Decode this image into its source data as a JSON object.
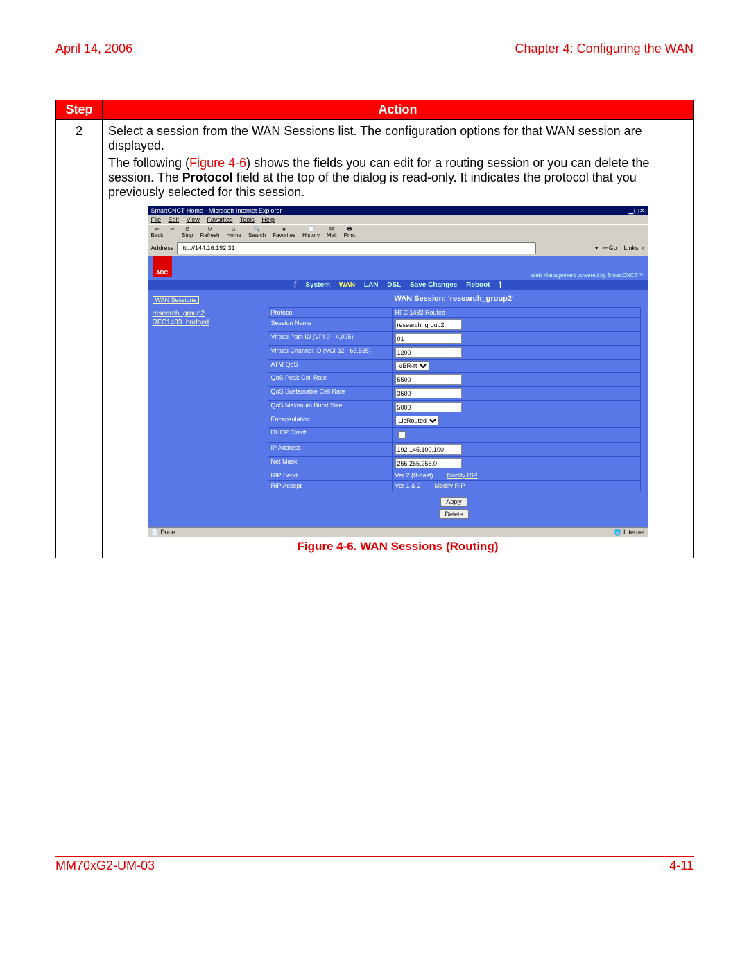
{
  "hdr": {
    "date": "April 14, 2006",
    "chap": "Chapter 4: Configuring the WAN"
  },
  "tbl": {
    "h1": "Step",
    "h2": "Action",
    "step": "2",
    "p1": "Select a session from the WAN Sessions list. The configuration options for that WAN session are displayed.",
    "p2a": "The following (",
    "figref": "Figure 4-6",
    "p2b": ") shows the fields you can edit for a routing session or you can delete the session. The ",
    "bold": "Protocol",
    "p2c": " field at the top of the dialog is read-only. It indicates the protocol that you previously selected for this session."
  },
  "figcap": "Figure 4-6. WAN Sessions (Routing)",
  "ie": {
    "title": "SmartCNCT Home - Microsoft Internet Explorer",
    "menu": [
      "File",
      "Edit",
      "View",
      "Favorites",
      "Tools",
      "Help"
    ],
    "tb": [
      "Back",
      "",
      "Stop",
      "Refresh",
      "Home",
      "Search",
      "Favorites",
      "History",
      "Mail",
      "Print"
    ],
    "addrlbl": "Address",
    "addr": "http://144.16.192.31",
    "go": "Go",
    "links": "Links",
    "statusL": "Done",
    "statusR": "Internet"
  },
  "app": {
    "logo": "ADC",
    "tag": "Web Management powered by SmartCNCT™",
    "nav": {
      "pre": "[",
      "sys": "System",
      "wan": "WAN",
      "lan": "LAN",
      "dsl": "DSL",
      "save": "Save Changes",
      "reboot": "Reboot",
      "post": "]"
    },
    "side": {
      "hd": "WAN Sessions",
      "l1": "research_group2",
      "l2": "RFC1483_bridged"
    },
    "cfgtitle": "WAN Session: 'research_group2'",
    "rows": [
      {
        "l": "Protocol",
        "t": "static",
        "v": "RFC 1483 Routed"
      },
      {
        "l": "Session Name",
        "t": "text",
        "v": "research_group2"
      },
      {
        "l": "Virtual Path ID (VPI 0 - 4,095)",
        "t": "text",
        "v": "01"
      },
      {
        "l": "Virtual Channel ID (VCI 32 - 65,535)",
        "t": "text",
        "v": "1200"
      },
      {
        "l": "ATM QoS",
        "t": "select",
        "v": "VBR-rt"
      },
      {
        "l": "QoS Peak Cell Rate",
        "t": "text",
        "v": "5500"
      },
      {
        "l": "QoS Sustainable Cell Rate",
        "t": "text",
        "v": "3500"
      },
      {
        "l": "QoS Maximum Burst Size",
        "t": "text",
        "v": "5000"
      },
      {
        "l": "Encapsulation",
        "t": "select",
        "v": "LlcRouted"
      },
      {
        "l": "DHCP Client",
        "t": "check",
        "v": ""
      },
      {
        "l": "IP Address",
        "t": "text",
        "v": "192.145.100.100"
      },
      {
        "l": "Net Mask",
        "t": "text",
        "v": "255.255.255.0"
      },
      {
        "l": "RIP Send",
        "t": "link",
        "v": "Ver 2 (B-cast)",
        "m": "Modify RIP"
      },
      {
        "l": "RIP Accept",
        "t": "link",
        "v": "Ver 1  & 2",
        "m": "Modify RIP"
      }
    ],
    "apply": "Apply",
    "delete": "Delete"
  },
  "ftr": {
    "l": "MM70xG2-UM-03",
    "r": "4-11"
  }
}
